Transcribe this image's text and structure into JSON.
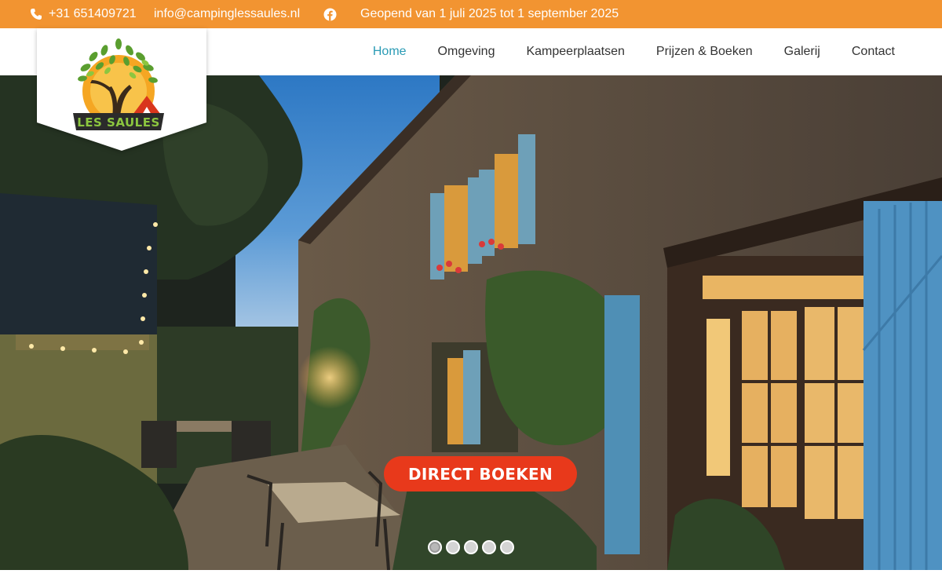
{
  "topbar": {
    "phone": "+31 651409721",
    "email": "info@campinglessaules.nl",
    "facebook_icon": "facebook-icon",
    "hours": "Geopend van 1 juli 2025 tot 1 september 2025",
    "background": "#f29431"
  },
  "logo": {
    "text": "LES SAULES"
  },
  "nav": {
    "items": [
      {
        "label": "Home",
        "active": true
      },
      {
        "label": "Omgeving"
      },
      {
        "label": "Kampeerplaatsen"
      },
      {
        "label": "Prijzen & Boeken"
      },
      {
        "label": "Galerij"
      },
      {
        "label": "Contact"
      }
    ],
    "active_color": "#2a9bb5"
  },
  "hero": {
    "cta_label": "DIRECT BOEKEN",
    "cta_color": "#e8391b",
    "slide_count": 5,
    "active_slide": 1
  }
}
